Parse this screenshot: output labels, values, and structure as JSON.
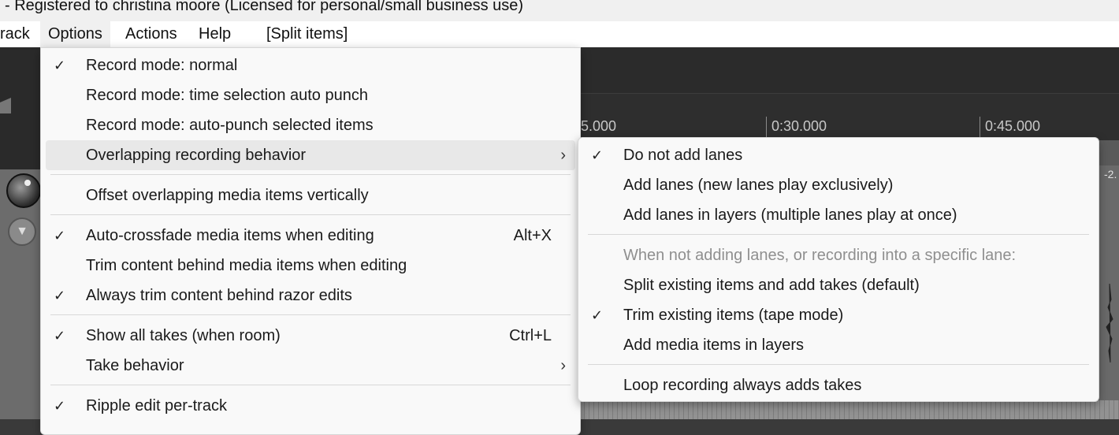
{
  "title_bar": {
    "text": " - Registered to christina moore (Licensed for personal/small business use)"
  },
  "menubar": {
    "items": [
      "rack",
      "Options",
      "Actions",
      "Help",
      "[Split items]"
    ]
  },
  "ruler": {
    "labels": [
      "5.000",
      "0:30.000",
      "0:45.000"
    ]
  },
  "track": {
    "volume_label": "-2."
  },
  "options_menu": {
    "items": [
      {
        "label": "Record mode: normal",
        "checked": true,
        "check": "✓"
      },
      {
        "label": "Record mode: time selection auto punch",
        "checked": false
      },
      {
        "label": "Record mode: auto-punch selected items",
        "checked": false
      },
      {
        "label": "Overlapping recording behavior",
        "submenu": true,
        "arrow": "›"
      },
      {
        "label": "Offset overlapping media items vertically",
        "checked": false
      },
      {
        "label": "Auto-crossfade media items when editing",
        "checked": true,
        "check": "✓",
        "shortcut": "Alt+X"
      },
      {
        "label": "Trim content behind media items when editing",
        "checked": false
      },
      {
        "label": "Always trim content behind razor edits",
        "checked": true,
        "check": "✓"
      },
      {
        "label": "Show all takes (when room)",
        "checked": true,
        "check": "✓",
        "shortcut": "Ctrl+L"
      },
      {
        "label": "Take behavior",
        "submenu": true,
        "arrow": "›"
      },
      {
        "label": "Ripple edit per-track",
        "checked": true,
        "check": "✓"
      }
    ]
  },
  "overlap_submenu": {
    "items": [
      {
        "label": "Do not add lanes",
        "checked": true,
        "check": "✓"
      },
      {
        "label": "Add lanes (new lanes play exclusively)",
        "checked": false
      },
      {
        "label": "Add lanes in layers (multiple lanes play at once)",
        "checked": false
      },
      {
        "label": "When not adding lanes, or recording into a specific lane:",
        "disabled": true
      },
      {
        "label": "Split existing items and add takes (default)",
        "checked": false
      },
      {
        "label": "Trim existing items (tape mode)",
        "checked": true,
        "check": "✓"
      },
      {
        "label": "Add media items in layers",
        "checked": false
      },
      {
        "label": "Loop recording always adds takes",
        "checked": false
      }
    ]
  },
  "colors": {
    "menu_bg": "#f9f9f9",
    "hover_bg": "#e8e8e8",
    "disabled_text": "#8f8f8f"
  }
}
